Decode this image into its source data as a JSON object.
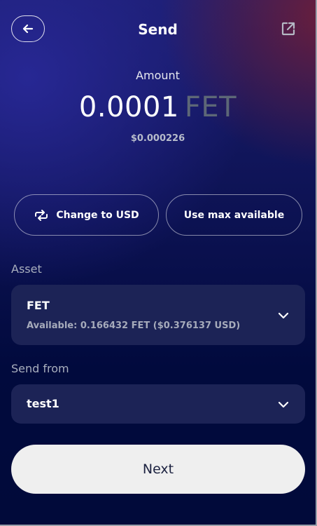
{
  "header": {
    "title": "Send",
    "back_icon": "arrow-left-icon",
    "external_icon": "external-link-icon"
  },
  "amount": {
    "label": "Amount",
    "value": "0.0001",
    "unit": "FET",
    "usd_value": "$0.000226"
  },
  "actions": {
    "change_currency_label": "Change to USD",
    "change_currency_icon": "swap-arrows-icon",
    "max_label": "Use max available"
  },
  "asset": {
    "section_label": "Asset",
    "name": "FET",
    "available": "Available: 0.166432 FET ($0.376137 USD)"
  },
  "send_from": {
    "section_label": "Send from",
    "account": "test1"
  },
  "footer": {
    "next_label": "Next"
  },
  "colors": {
    "unit_gray": "#5d6777",
    "card_bg": "#1c2356",
    "button_bg": "#efefef"
  }
}
